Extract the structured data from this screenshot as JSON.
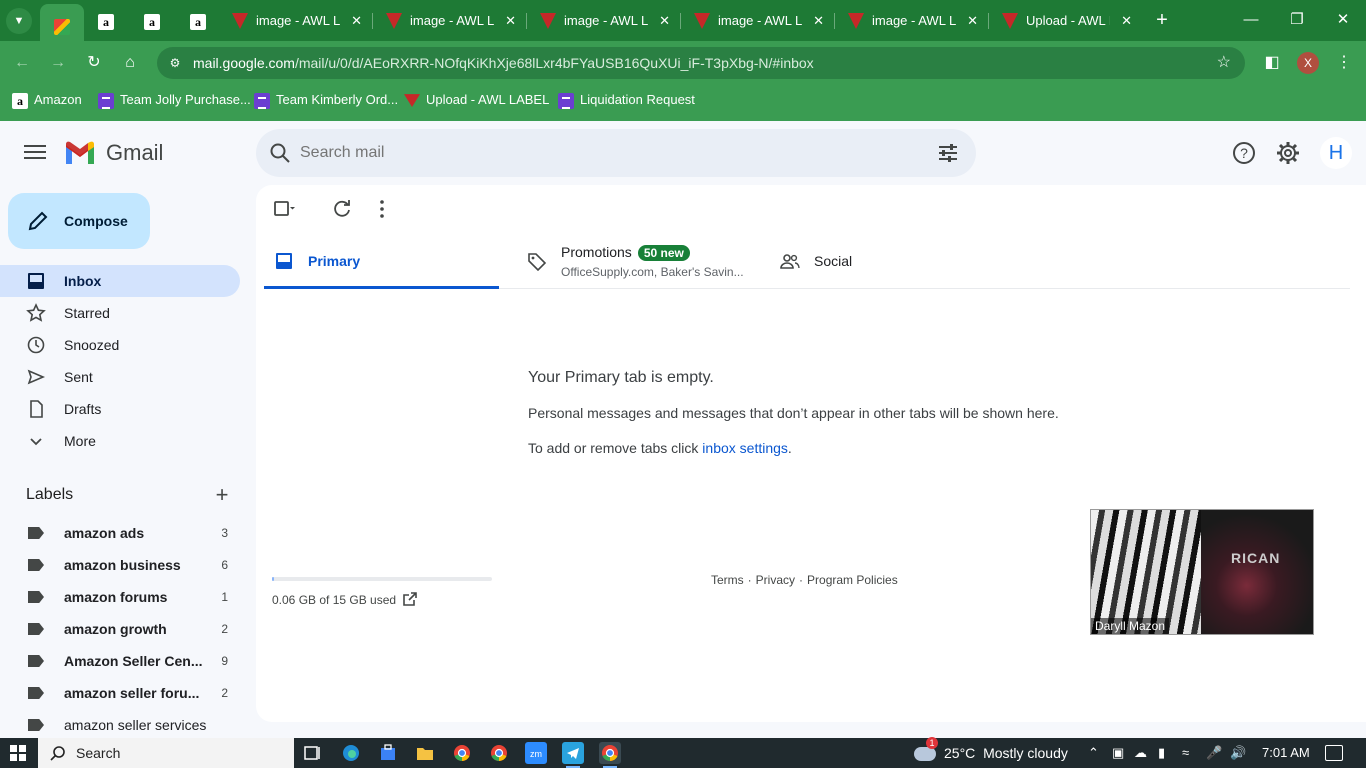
{
  "browser": {
    "tabs": [
      {
        "kind": "gmail",
        "active": true
      },
      {
        "kind": "amazon"
      },
      {
        "kind": "amazon"
      },
      {
        "kind": "amazon"
      },
      {
        "kind": "awl",
        "title": "image - AWL LA"
      },
      {
        "kind": "awl",
        "title": "image - AWL LA"
      },
      {
        "kind": "awl",
        "title": "image - AWL LA"
      },
      {
        "kind": "awl",
        "title": "image - AWL LA"
      },
      {
        "kind": "awl",
        "title": "image - AWL LA"
      },
      {
        "kind": "awl",
        "title": "Upload - AWL L"
      }
    ],
    "url_host": "mail.google.com",
    "url_path": "/mail/u/0/d/AEoRXRR-NOfqKiKhXje68lLxr4bFYaUSB16QuXUi_iF-T3pXbg-N/#inbox",
    "profile_initial": "X",
    "bookmarks": [
      {
        "label": "Amazon",
        "icon": "amazon-icon"
      },
      {
        "label": "Team Jolly Purchase...",
        "icon": "list-icon"
      },
      {
        "label": "Team Kimberly Ord...",
        "icon": "list-icon"
      },
      {
        "label": "Upload - AWL LABEL",
        "icon": "awl-icon"
      },
      {
        "label": "Liquidation Request",
        "icon": "list-icon"
      }
    ]
  },
  "gmail": {
    "logo_text": "Gmail",
    "search_placeholder": "Search mail",
    "avatar_initial": "H",
    "compose_label": "Compose",
    "nav": [
      {
        "label": "Inbox",
        "icon": "inbox-icon",
        "active": true
      },
      {
        "label": "Starred",
        "icon": "star-icon"
      },
      {
        "label": "Snoozed",
        "icon": "clock-icon"
      },
      {
        "label": "Sent",
        "icon": "send-icon"
      },
      {
        "label": "Drafts",
        "icon": "draft-icon"
      },
      {
        "label": "More",
        "icon": "chevron-down-icon"
      }
    ],
    "labels_heading": "Labels",
    "labels": [
      {
        "name": "amazon ads",
        "count": "3",
        "bold": true
      },
      {
        "name": "amazon business",
        "count": "6",
        "bold": true
      },
      {
        "name": "amazon forums",
        "count": "1",
        "bold": true
      },
      {
        "name": "amazon growth",
        "count": "2",
        "bold": true
      },
      {
        "name": "Amazon Seller Cen...",
        "count": "9",
        "bold": true
      },
      {
        "name": "amazon seller foru...",
        "count": "2",
        "bold": true
      },
      {
        "name": "amazon seller services",
        "count": "",
        "bold": false
      }
    ],
    "tabs": {
      "primary": "Primary",
      "promotions": "Promotions",
      "promotions_badge": "50 new",
      "promotions_sub": "OfficeSupply.com, Baker's Savin...",
      "social": "Social"
    },
    "empty": {
      "title": "Your Primary tab is empty.",
      "desc": "Personal messages and messages that don’t appear in other tabs will be shown here.",
      "tip_prefix": "To add or remove tabs click ",
      "tip_link": "inbox settings",
      "tip_suffix": "."
    },
    "storage": {
      "text": "0.06 GB of 15 GB used",
      "fraction": 0.004
    },
    "footer": {
      "terms": "Terms",
      "privacy": "Privacy",
      "policies": "Program Policies",
      "sep": "·"
    },
    "video": {
      "name": "Daryll Mazon",
      "overlay_text": "RICAN"
    }
  },
  "taskbar": {
    "search": "Search",
    "weather_temp": "25°C",
    "weather_desc": "Mostly cloudy",
    "weather_badge": "1",
    "time": "7:01 AM"
  },
  "colors": {
    "chrome_dark": "#1e7a35",
    "chrome_light": "#3a9c52",
    "gmail_accent": "#0b57d0",
    "compose_bg": "#c2e7ff",
    "badge_green": "#188038"
  }
}
